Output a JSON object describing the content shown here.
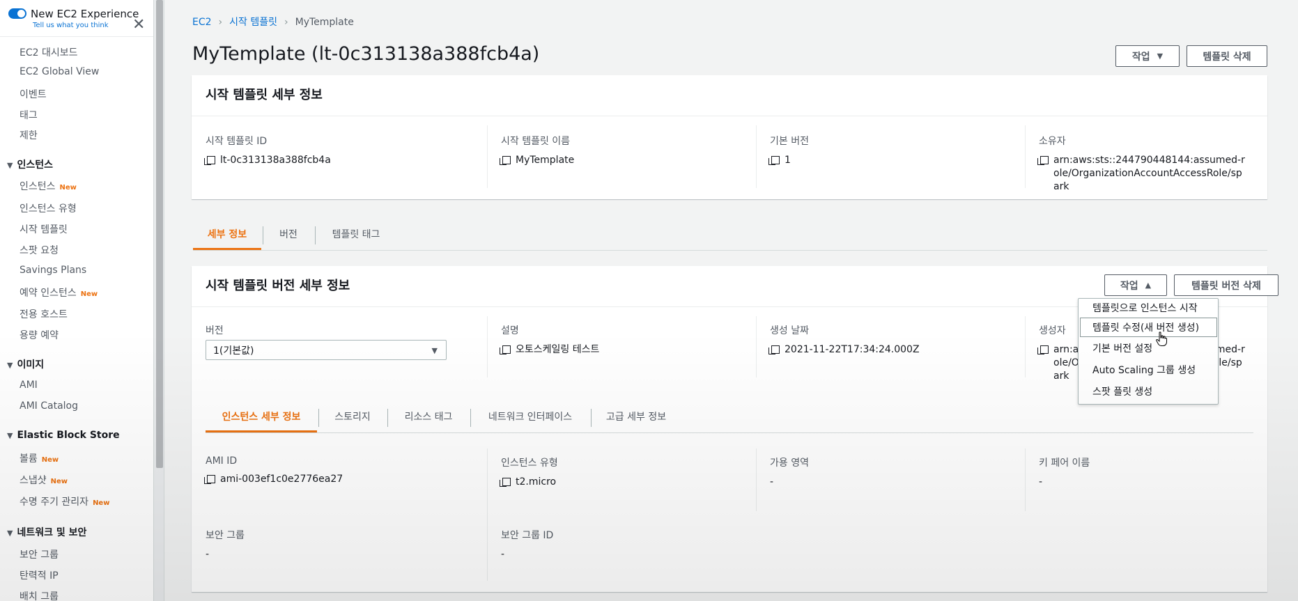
{
  "sidebar": {
    "new_experience": {
      "title": "New EC2 Experience",
      "subtitle": "Tell us what you think"
    },
    "top_items": [
      {
        "label": "EC2 대시보드"
      },
      {
        "label": "EC2 Global View"
      },
      {
        "label": "이벤트"
      },
      {
        "label": "태그"
      },
      {
        "label": "제한"
      }
    ],
    "sections": [
      {
        "title": "인스턴스",
        "items": [
          {
            "label": "인스턴스",
            "badge": "New"
          },
          {
            "label": "인스턴스 유형",
            "badge": ""
          },
          {
            "label": "시작 템플릿",
            "badge": ""
          },
          {
            "label": "스팟 요청",
            "badge": ""
          },
          {
            "label": "Savings Plans",
            "badge": ""
          },
          {
            "label": "예약 인스턴스",
            "badge": "New"
          },
          {
            "label": "전용 호스트",
            "badge": ""
          },
          {
            "label": "용량 예약",
            "badge": ""
          }
        ]
      },
      {
        "title": "이미지",
        "items": [
          {
            "label": "AMI",
            "badge": ""
          },
          {
            "label": "AMI Catalog",
            "badge": ""
          }
        ]
      },
      {
        "title": "Elastic Block Store",
        "items": [
          {
            "label": "볼륨",
            "badge": "New"
          },
          {
            "label": "스냅샷",
            "badge": "New"
          },
          {
            "label": "수명 주기 관리자",
            "badge": "New"
          }
        ]
      },
      {
        "title": "네트워크 및 보안",
        "items": [
          {
            "label": "보안 그룹",
            "badge": ""
          },
          {
            "label": "탄력적 IP",
            "badge": ""
          },
          {
            "label": "배치 그룹",
            "badge": ""
          }
        ]
      }
    ]
  },
  "breadcrumb": {
    "root": "EC2",
    "parent": "시작 템플릿",
    "current": "MyTemplate"
  },
  "page_title": "MyTemplate (lt-0c313138a388fcb4a)",
  "header_buttons": {
    "actions": "작업",
    "delete_template": "템플릿 삭제"
  },
  "template_details": {
    "title": "시작 템플릿 세부 정보",
    "fields": [
      {
        "label": "시작 템플릿 ID",
        "value": "lt-0c313138a388fcb4a"
      },
      {
        "label": "시작 템플릿 이름",
        "value": "MyTemplate"
      },
      {
        "label": "기본 버전",
        "value": "1"
      },
      {
        "label": "소유자",
        "value": "arn:aws:sts::244790448144:assumed-role/OrganizationAccountAccessRole/spark"
      }
    ]
  },
  "main_tabs": [
    "세부 정보",
    "버전",
    "템플릿 태그"
  ],
  "version_details": {
    "title": "시작 템플릿 버전 세부 정보",
    "actions": "작업",
    "delete_version": "템플릿 버전 삭제",
    "version_label": "버전",
    "version_selected": "1(기본값)",
    "description_label": "설명",
    "description_value": "오토스케일링 테스트",
    "created_label": "생성 날짜",
    "created_value": "2021-11-22T17:34:24.000Z",
    "creator_label": "생성자",
    "creator_value": "arn:aws:sts::244790448144:assumed-role/OrganizationAccountAccessRole/spark"
  },
  "actions_menu": [
    "템플릿으로 인스턴스 시작",
    "템플릿 수정(새 버전 생성)",
    "기본 버전 설정",
    "Auto Scaling 그룹 생성",
    "스팟 플릿 생성"
  ],
  "sub_tabs": [
    "인스턴스 세부 정보",
    "스토리지",
    "리소스 태그",
    "네트워크 인터페이스",
    "고급 세부 정보"
  ],
  "instance_details": {
    "row1": [
      {
        "label": "AMI ID",
        "value": "ami-003ef1c0e2776ea27"
      },
      {
        "label": "인스턴스 유형",
        "value": "t2.micro"
      },
      {
        "label": "가용 영역",
        "value": "-"
      },
      {
        "label": "키 페어 이름",
        "value": "-"
      }
    ],
    "row2": [
      {
        "label": "보안 그룹",
        "value": "-"
      },
      {
        "label": "보안 그룹 ID",
        "value": "-"
      }
    ]
  },
  "colors": {
    "accent": "#ec7211",
    "link": "#0972d3",
    "text": "#16191f",
    "muted": "#545b64"
  }
}
